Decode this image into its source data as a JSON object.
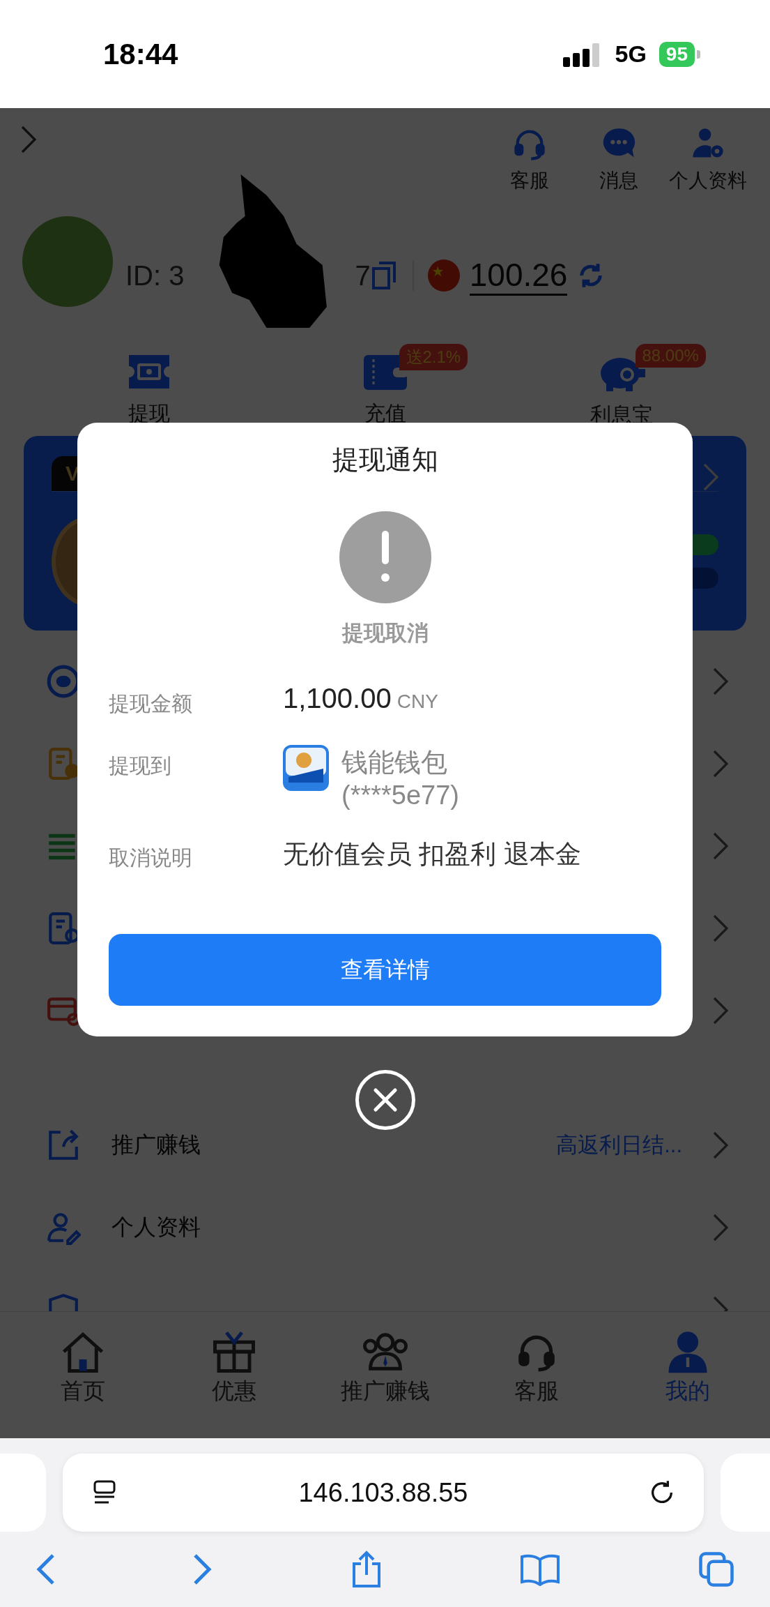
{
  "status_bar": {
    "time": "18:44",
    "network": "5G",
    "battery": "95"
  },
  "header": {
    "shortcuts": [
      {
        "kind": "headset",
        "label": "客服"
      },
      {
        "kind": "chat",
        "label": "消息"
      },
      {
        "kind": "profile",
        "label": "个人资料"
      }
    ],
    "user": {
      "id_start": "ID: 3",
      "id_end": "7",
      "balance": "100.26"
    },
    "actions": [
      {
        "kind": "withdraw",
        "label": "提现"
      },
      {
        "kind": "wallet",
        "label": "充值",
        "badge": "送2.1%"
      },
      {
        "kind": "piggy",
        "label": "利息宝",
        "badge": "88.00%"
      }
    ]
  },
  "vip_card": {
    "tag": "V"
  },
  "menu": [
    {
      "kind": "share",
      "label": "推广赚钱",
      "note": "高返利日结..."
    },
    {
      "kind": "person",
      "label": "个人资料"
    }
  ],
  "tab_bar": [
    {
      "kind": "home",
      "label": "首页",
      "selected": false
    },
    {
      "kind": "gift",
      "label": "优惠",
      "selected": false
    },
    {
      "kind": "team",
      "label": "推广赚钱",
      "selected": false
    },
    {
      "kind": "headset",
      "label": "客服",
      "selected": false
    },
    {
      "kind": "me",
      "label": "我的",
      "selected": true
    }
  ],
  "dialog": {
    "title": "提现通知",
    "status": "提现取消",
    "rows": [
      {
        "kind": "amount",
        "label": "提现金额",
        "value": "1,100.00",
        "unit": "CNY"
      },
      {
        "kind": "wallet",
        "label": "提现到",
        "value": "钱能钱包",
        "account": "(****5e77)"
      },
      {
        "kind": "text",
        "label": "取消说明",
        "value": "无价值会员 扣盈利 退本金"
      }
    ],
    "button": "查看详情"
  },
  "browser": {
    "url": "146.103.88.55"
  }
}
